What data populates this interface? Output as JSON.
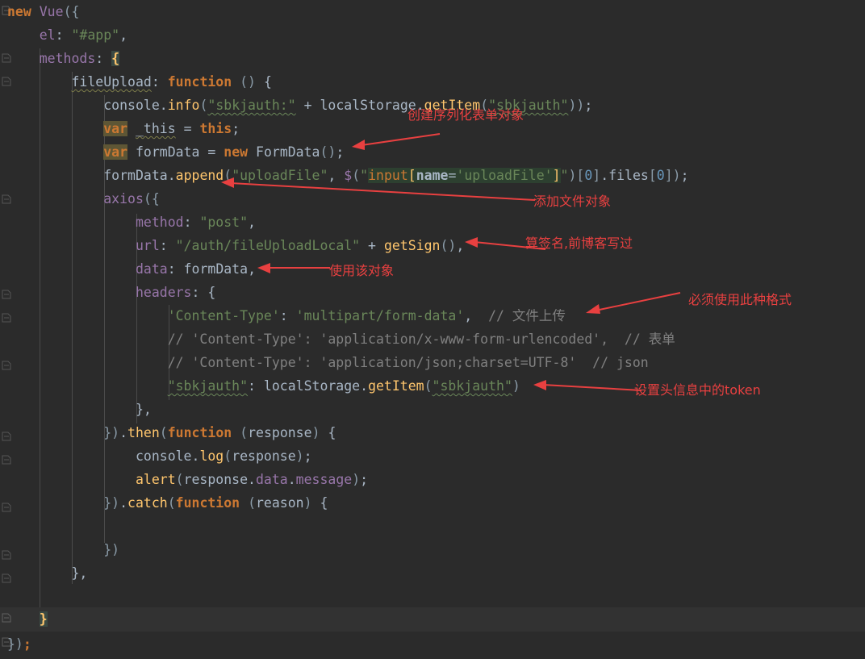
{
  "editor": {
    "theme": "darcula",
    "background": "#2b2b2b",
    "current_line_background": "#323232",
    "default_text_color": "#a9b7c6",
    "keyword_color": "#cc7832",
    "string_color": "#6a8759",
    "number_color": "#6897bb",
    "function_color": "#ffc66d",
    "property_color": "#9876aa",
    "comment_color": "#808080",
    "annotation_color": "#e84040",
    "brace_match_highlight": "#3a4a44",
    "var_usage_highlight": "#5e5635",
    "selection_highlight": "#2d4030"
  },
  "code": {
    "language": "javascript",
    "lines": [
      "new Vue({",
      "    el: \"#app\",",
      "    methods: {",
      "        fileUpload: function () {",
      "            console.info(\"sbkjauth:\" + localStorage.getItem(\"sbkjauth\"));",
      "            var _this = this;",
      "            var formData = new FormData();",
      "            formData.append(\"uploadFile\", $(\"input[name='uploadFile']\")[0].files[0]);",
      "            axios({",
      "                method: \"post\",",
      "                url: \"/auth/fileUploadLocal\" + getSign(),",
      "                data: formData,",
      "                headers: {",
      "                    'Content-Type': 'multipart/form-data',  // 文件上传",
      "                    // 'Content-Type': 'application/x-www-form-urlencoded',  // 表单",
      "                    // 'Content-Type': 'application/json;charset=UTF-8'  // json",
      "                    \"sbkjauth\": localStorage.getItem(\"sbkjauth\")",
      "                },",
      "            }).then(function (response) {",
      "                console.log(response);",
      "                alert(response.data.message);",
      "            }).catch(function (reason) {",
      "",
      "            })",
      "        },",
      "",
      "    }",
      "});"
    ]
  },
  "annotations": [
    {
      "id": "a1",
      "text": "创建序列化表单对象",
      "target_line": "var formData = new FormData();"
    },
    {
      "id": "a2",
      "text": "添加文件对象",
      "target_line": "formData.append(\"uploadFile\", ...)"
    },
    {
      "id": "a3",
      "text": "算签名,前博客写过",
      "target_line": "url: \"/auth/fileUploadLocal\" + getSign(),"
    },
    {
      "id": "a4",
      "text": "使用该对象",
      "target_line": "data: formData,"
    },
    {
      "id": "a5",
      "text": "必须使用此种格式",
      "target_line": "'Content-Type': 'multipart/form-data',"
    },
    {
      "id": "a6",
      "text": "设置头信息中的token",
      "target_line": "\"sbkjauth\": localStorage.getItem(\"sbkjauth\")"
    }
  ]
}
